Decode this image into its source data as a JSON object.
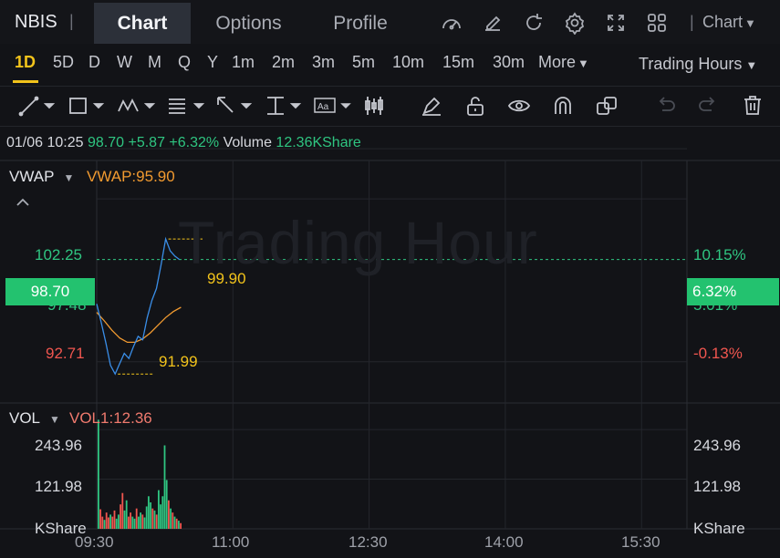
{
  "header": {
    "ticker": "NBIS",
    "separator": "|",
    "tabs": [
      {
        "label": "Chart",
        "active": true
      },
      {
        "label": "Options",
        "active": false
      },
      {
        "label": "Profile",
        "active": false
      }
    ],
    "icons": [
      "gauge-icon",
      "pencil-edit-icon",
      "refresh-icon",
      "gear-icon",
      "expand-icon",
      "grid-icon"
    ],
    "chart_dropdown": "Chart"
  },
  "periods": [
    "1D",
    "5D",
    "D",
    "W",
    "M",
    "Q",
    "Y",
    "1m",
    "2m",
    "3m",
    "5m",
    "10m",
    "15m",
    "30m",
    "More"
  ],
  "active_period": "1D",
  "trading_hours": "Trading Hours",
  "toolbar_icons": [
    "line-draw-icon",
    "rectangle-draw-icon",
    "pattern-draw-icon",
    "fib-draw-icon",
    "arrow-draw-icon",
    "measure-draw-icon",
    "text-draw-icon",
    "candle-draw-icon",
    "brush-icon",
    "unlock-icon",
    "eye-icon",
    "magnet-icon",
    "copy-icon",
    "undo-icon",
    "redo-icon",
    "trash-icon"
  ],
  "info": {
    "datetime": "01/06 10:25",
    "price": "98.70",
    "change": "+5.87",
    "change_pct": "+6.32%",
    "volume_label": "Volume",
    "volume": "12.36KShare"
  },
  "price_panel": {
    "indicator": "VWAP",
    "indicator_value": "VWAP:95.90",
    "watermark": "Trading Hour",
    "left_axis": {
      "top": "102.25",
      "partial": "97.48",
      "bottom": "92.71"
    },
    "right_axis": {
      "top": "10.15%",
      "partial": "5.01%",
      "bottom": "-0.13%"
    },
    "current_price": "98.70",
    "current_pct": "6.32%",
    "high_label": "99.90",
    "low_label": "91.99"
  },
  "volume_panel": {
    "indicator": "VOL",
    "indicator_value": "VOL1:12.36",
    "left_axis": [
      "243.96",
      "121.98",
      "KShare"
    ],
    "right_axis": [
      "243.96",
      "121.98",
      "KShare"
    ]
  },
  "time_axis": [
    "09:30",
    "11:00",
    "12:30",
    "14:00",
    "15:30"
  ],
  "colors": {
    "up": "#2fc581",
    "down": "#f0564f",
    "accent": "#f2c31b",
    "vwap": "#f19a30",
    "price_line": "#3a8ee8"
  },
  "chart_data": {
    "type": "line",
    "x_label": "",
    "y_label": "",
    "ylim": [
      90.4,
      104.5
    ],
    "series": [
      {
        "name": "VWAP",
        "x_minutes": [
          0,
          5,
          10,
          15,
          20,
          25,
          30,
          35,
          40,
          45,
          50,
          55
        ],
        "values": [
          95.6,
          95.1,
          94.55,
          94.1,
          93.85,
          93.85,
          94.05,
          94.4,
          94.85,
          95.3,
          95.65,
          95.9
        ]
      },
      {
        "name": "",
        "x_minutes": [
          0,
          3,
          6,
          9,
          12,
          15,
          18,
          21,
          24,
          27,
          30,
          33,
          36,
          39,
          42,
          45,
          48,
          51,
          54
        ],
        "values": [
          96.1,
          95.0,
          93.8,
          92.5,
          91.99,
          92.6,
          93.2,
          92.9,
          93.6,
          94.2,
          94.0,
          95.3,
          96.3,
          97.0,
          98.4,
          99.9,
          99.2,
          98.9,
          98.7
        ]
      }
    ],
    "volume": {
      "ylim": [
        0,
        280
      ],
      "bars": [
        {
          "v": 268,
          "c": "up"
        },
        {
          "v": 48,
          "c": "down"
        },
        {
          "v": 30,
          "c": "down"
        },
        {
          "v": 22,
          "c": "up"
        },
        {
          "v": 40,
          "c": "down"
        },
        {
          "v": 28,
          "c": "down"
        },
        {
          "v": 35,
          "c": "up"
        },
        {
          "v": 30,
          "c": "down"
        },
        {
          "v": 45,
          "c": "down"
        },
        {
          "v": 25,
          "c": "up"
        },
        {
          "v": 35,
          "c": "up"
        },
        {
          "v": 60,
          "c": "down"
        },
        {
          "v": 88,
          "c": "down"
        },
        {
          "v": 45,
          "c": "up"
        },
        {
          "v": 70,
          "c": "up"
        },
        {
          "v": 30,
          "c": "down"
        },
        {
          "v": 40,
          "c": "down"
        },
        {
          "v": 30,
          "c": "up"
        },
        {
          "v": 25,
          "c": "up"
        },
        {
          "v": 50,
          "c": "down"
        },
        {
          "v": 30,
          "c": "up"
        },
        {
          "v": 40,
          "c": "up"
        },
        {
          "v": 35,
          "c": "down"
        },
        {
          "v": 28,
          "c": "up"
        },
        {
          "v": 55,
          "c": "up"
        },
        {
          "v": 80,
          "c": "up"
        },
        {
          "v": 65,
          "c": "up"
        },
        {
          "v": 50,
          "c": "down"
        },
        {
          "v": 45,
          "c": "up"
        },
        {
          "v": 35,
          "c": "down"
        },
        {
          "v": 95,
          "c": "up"
        },
        {
          "v": 60,
          "c": "up"
        },
        {
          "v": 80,
          "c": "up"
        },
        {
          "v": 205,
          "c": "up"
        },
        {
          "v": 120,
          "c": "up"
        },
        {
          "v": 70,
          "c": "down"
        },
        {
          "v": 50,
          "c": "up"
        },
        {
          "v": 40,
          "c": "down"
        },
        {
          "v": 30,
          "c": "up"
        },
        {
          "v": 25,
          "c": "down"
        },
        {
          "v": 20,
          "c": "up"
        },
        {
          "v": 14,
          "c": "down"
        }
      ]
    }
  }
}
